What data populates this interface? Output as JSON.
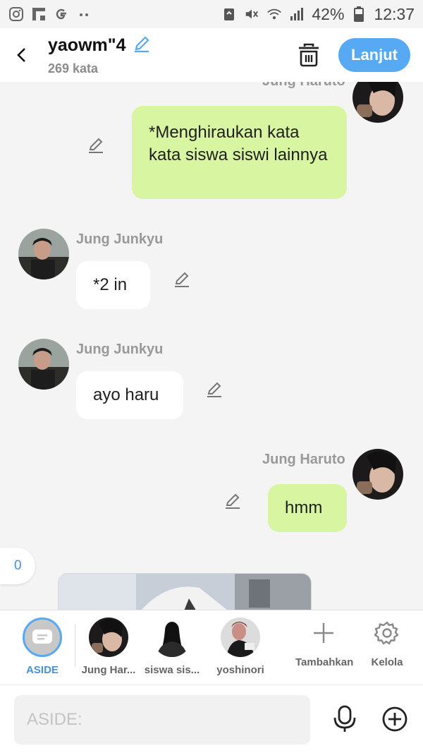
{
  "status_bar": {
    "left_icons": [
      "instagram-icon",
      "flipboard-icon",
      "google-icon",
      "more-dots-icon"
    ],
    "battery_percent": "42%",
    "time": "12:37"
  },
  "header": {
    "title": "yaowm\"4",
    "subtitle": "269 kata",
    "next_label": "Lanjut"
  },
  "chat": {
    "messages": [
      {
        "sender": "Jung Haruto",
        "text": "*Menghiraukan kata kata siswa siswi lainnya",
        "side": "right"
      },
      {
        "sender": "Jung Junkyu",
        "text": "*2 in",
        "side": "left"
      },
      {
        "sender": "Jung Junkyu",
        "text": "ayo haru",
        "side": "left"
      },
      {
        "sender": "Jung Haruto",
        "text": "hmm",
        "side": "right"
      }
    ],
    "counter": "0"
  },
  "characters": [
    {
      "name": "ASIDE",
      "active": true
    },
    {
      "name": "Jung Har...",
      "active": false
    },
    {
      "name": "siswa sis...",
      "active": false
    },
    {
      "name": "yoshinori",
      "active": false
    }
  ],
  "actions": {
    "add_label": "Tambahkan",
    "manage_label": "Kelola"
  },
  "composer": {
    "placeholder": "ASIDE:"
  },
  "colors": {
    "accent": "#57a9f4",
    "my_bubble": "#d8f5a2",
    "their_bubble": "#ffffff",
    "background": "#f4f4f4"
  }
}
